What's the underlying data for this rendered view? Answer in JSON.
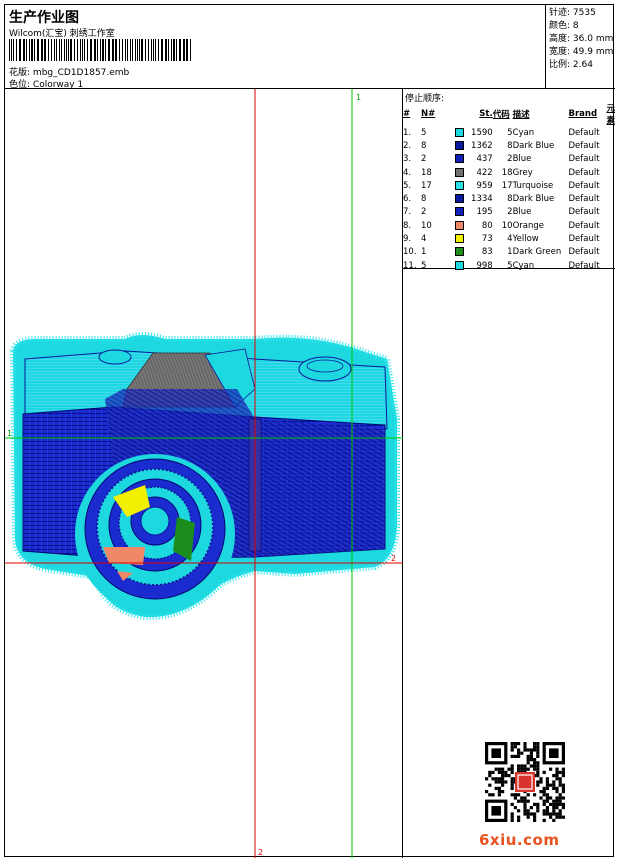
{
  "header": {
    "title": "生产作业图",
    "company": "Wilcom(汇宝) 刺绣工作室",
    "pattern_label": "花版:",
    "pattern_value": "mbg_CD1D1857.emb",
    "colorway_label": "色位:",
    "colorway_value": "Colorway 1"
  },
  "stats": [
    {
      "label": "针迹:",
      "value": "7535"
    },
    {
      "label": "颜色:",
      "value": "8"
    },
    {
      "label": "高度:",
      "value": "36.0 mm"
    },
    {
      "label": "宽度:",
      "value": "49.9 mm"
    },
    {
      "label": "比例:",
      "value": "2.64"
    }
  ],
  "guides": {
    "top_label": "1",
    "left_label": "1",
    "right_label": "2",
    "bottom_label": "2"
  },
  "stop_sequence": {
    "title": "停止顺序:",
    "headers": [
      "#",
      "N#",
      "St.",
      "代码",
      "描述",
      "Brand",
      "元素"
    ],
    "rows": [
      {
        "idx": "1.",
        "n": "5",
        "color": "#1ed8e0",
        "st": "1590",
        "code": "5",
        "desc": "Cyan",
        "brand": "Default"
      },
      {
        "idx": "2.",
        "n": "8",
        "color": "#0a1a9c",
        "st": "1362",
        "code": "8",
        "desc": "Dark Blue",
        "brand": "Default"
      },
      {
        "idx": "3.",
        "n": "2",
        "color": "#1020b8",
        "st": "437",
        "code": "2",
        "desc": "Blue",
        "brand": "Default"
      },
      {
        "idx": "4.",
        "n": "18",
        "color": "#707070",
        "st": "422",
        "code": "18",
        "desc": "Grey",
        "brand": "Default"
      },
      {
        "idx": "5.",
        "n": "17",
        "color": "#30e0e8",
        "st": "959",
        "code": "17",
        "desc": "Turquoise",
        "brand": "Default"
      },
      {
        "idx": "6.",
        "n": "8",
        "color": "#0a1a9c",
        "st": "1334",
        "code": "8",
        "desc": "Dark Blue",
        "brand": "Default"
      },
      {
        "idx": "7.",
        "n": "2",
        "color": "#1020b8",
        "st": "195",
        "code": "2",
        "desc": "Blue",
        "brand": "Default"
      },
      {
        "idx": "8.",
        "n": "10",
        "color": "#f08868",
        "st": "80",
        "code": "10",
        "desc": "Orange",
        "brand": "Default"
      },
      {
        "idx": "9.",
        "n": "4",
        "color": "#f0f000",
        "st": "73",
        "code": "4",
        "desc": "Yellow",
        "brand": "Default"
      },
      {
        "idx": "10.",
        "n": "1",
        "color": "#1c8c1c",
        "st": "83",
        "code": "1",
        "desc": "Dark Green",
        "brand": "Default"
      },
      {
        "idx": "11.",
        "n": "5",
        "color": "#1ed8e0",
        "st": "998",
        "code": "5",
        "desc": "Cyan",
        "brand": "Default"
      }
    ]
  },
  "watermark": "6xiu.com",
  "colors": {
    "guide_red": "#dd0000",
    "guide_green": "#00c800",
    "cyan": "#1ed8e0",
    "dark_blue": "#0a1a9c",
    "grey": "#707070"
  }
}
